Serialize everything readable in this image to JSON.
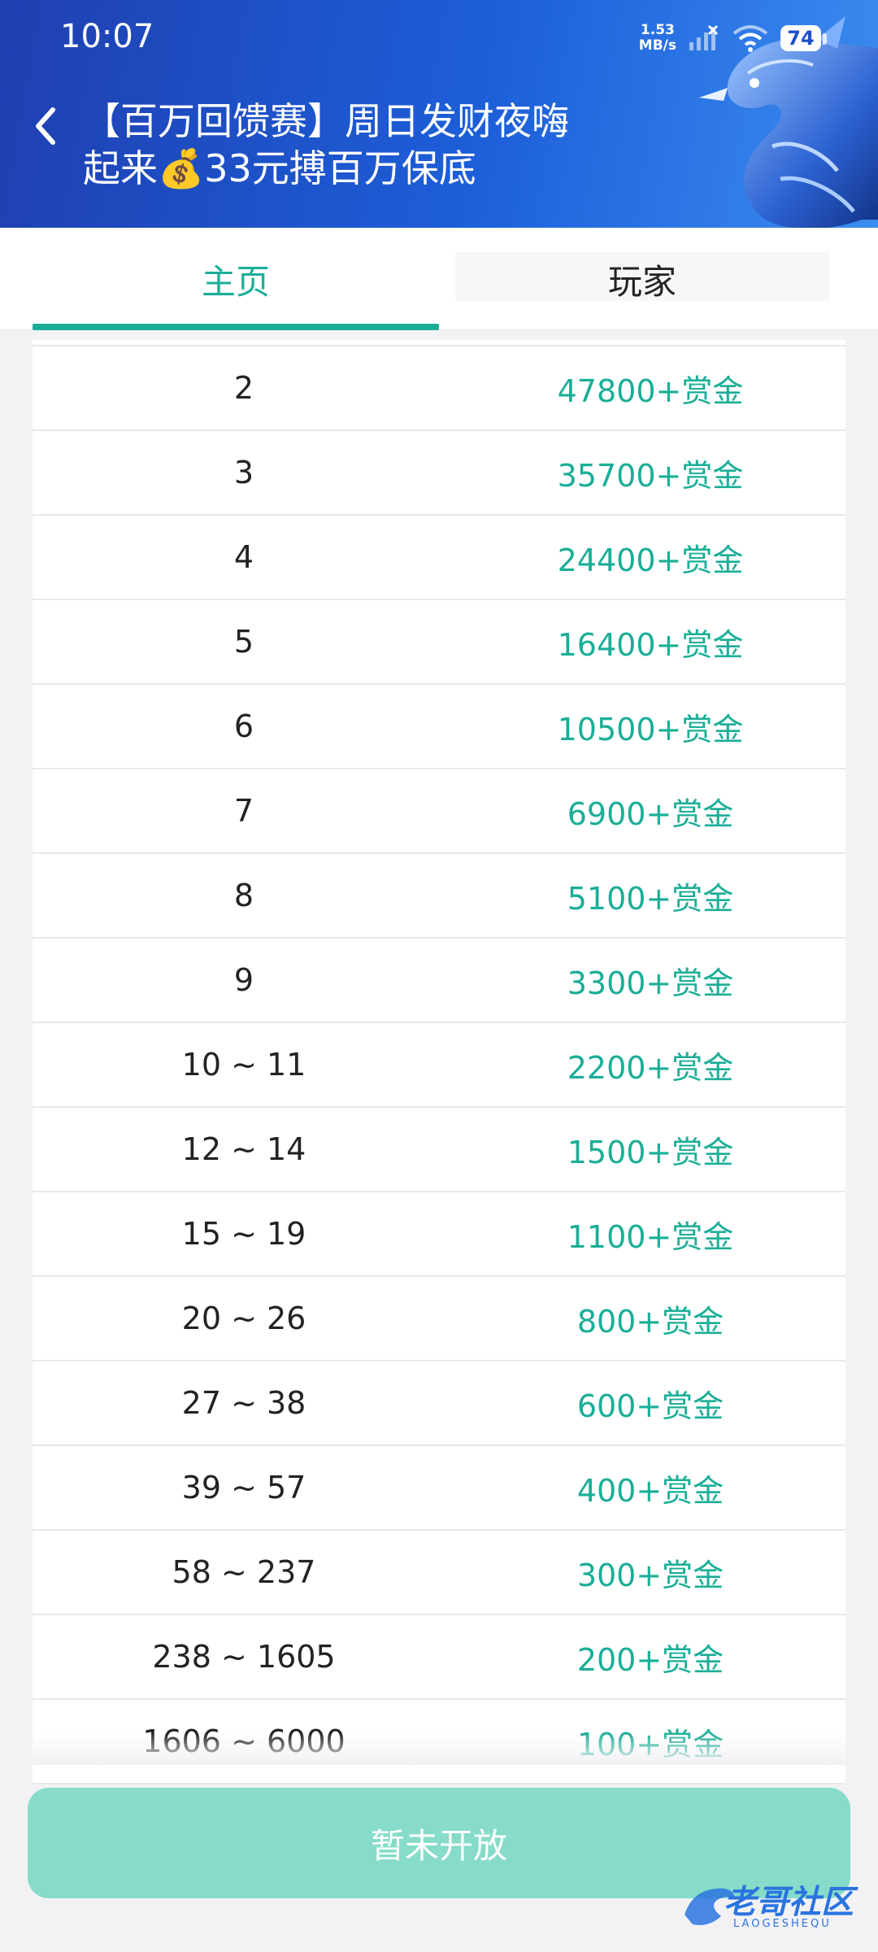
{
  "status": {
    "time": "10:07",
    "net_speed_value": "1.53",
    "net_speed_unit": "MB/s",
    "battery": "74"
  },
  "header": {
    "title_line1": "【百万回馈赛】周日发财夜嗨",
    "title_line2": "起来💰33元搏百万保底"
  },
  "tabs": {
    "home": "主页",
    "players": "玩家"
  },
  "prize_table": [
    {
      "rank": "2",
      "prize": "47800+赏金"
    },
    {
      "rank": "3",
      "prize": "35700+赏金"
    },
    {
      "rank": "4",
      "prize": "24400+赏金"
    },
    {
      "rank": "5",
      "prize": "16400+赏金"
    },
    {
      "rank": "6",
      "prize": "10500+赏金"
    },
    {
      "rank": "7",
      "prize": "6900+赏金"
    },
    {
      "rank": "8",
      "prize": "5100+赏金"
    },
    {
      "rank": "9",
      "prize": "3300+赏金"
    },
    {
      "rank": "10 ~ 11",
      "prize": "2200+赏金"
    },
    {
      "rank": "12 ~ 14",
      "prize": "1500+赏金"
    },
    {
      "rank": "15 ~ 19",
      "prize": "1100+赏金"
    },
    {
      "rank": "20 ~ 26",
      "prize": "800+赏金"
    },
    {
      "rank": "27 ~ 38",
      "prize": "600+赏金"
    },
    {
      "rank": "39 ~ 57",
      "prize": "400+赏金"
    },
    {
      "rank": "58 ~ 237",
      "prize": "300+赏金"
    },
    {
      "rank": "238 ~ 1605",
      "prize": "200+赏金"
    },
    {
      "rank": "1606 ~ 6000",
      "prize": "100+赏金"
    }
  ],
  "bottom_button": "暂未开放",
  "watermark": {
    "text": "老哥社区",
    "sub": "LAOGESHEQU"
  },
  "icons": {
    "back": "chevron-left-icon",
    "wifi": "wifi-icon",
    "signal": "cell-signal-icon",
    "battery": "battery-icon"
  },
  "colors": {
    "accent": "#1aae97",
    "header_start": "#1f3fb0",
    "header_end": "#3b8cf0",
    "button_disabled": "#86dcc9"
  }
}
